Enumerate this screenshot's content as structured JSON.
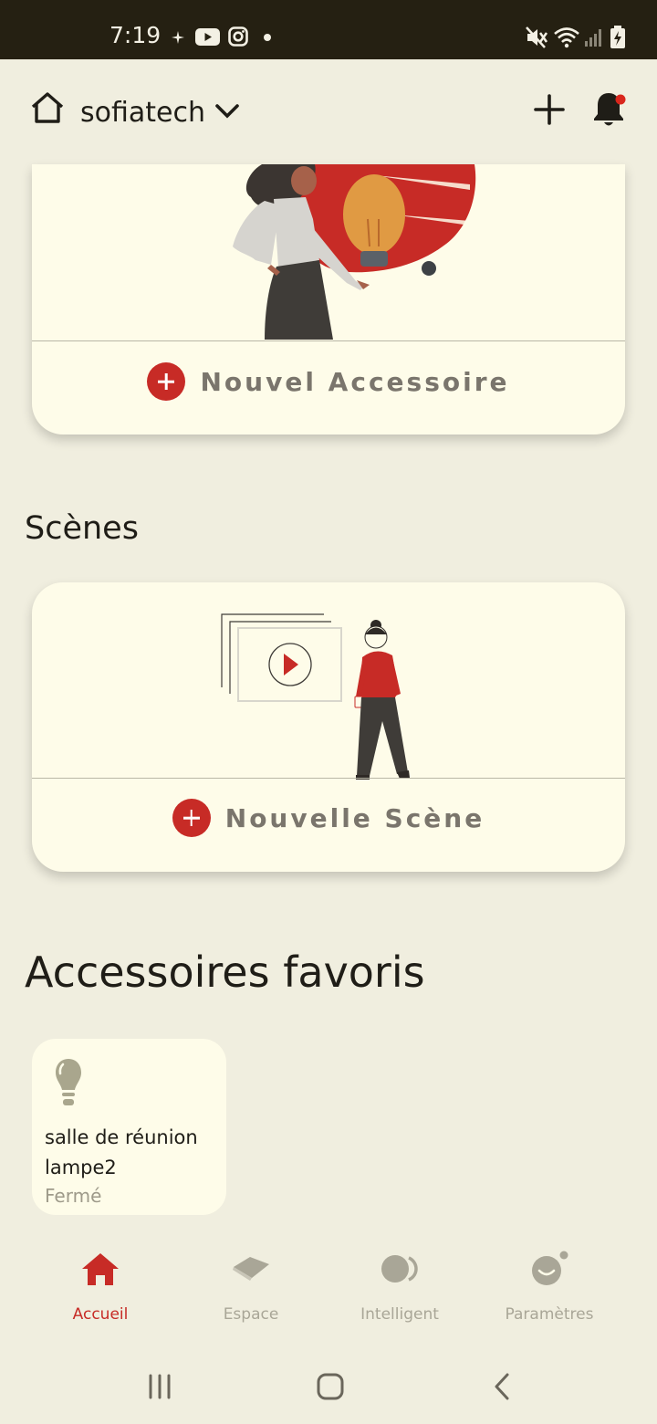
{
  "status_bar": {
    "time": "7:19",
    "left_icons": [
      "sparkle-icon",
      "youtube-icon",
      "instagram-icon",
      "dot-icon"
    ],
    "right_icons": [
      "mute-icon",
      "wifi-icon",
      "signal-icon",
      "battery-charging-icon"
    ]
  },
  "header": {
    "home_name": "sofiatech",
    "icons": [
      "home-icon",
      "chevron-down-icon",
      "add-icon",
      "bell-icon"
    ],
    "notification_dot_color": "#d9261c"
  },
  "accessory_card": {
    "add_label": "Nouvel Accessoire"
  },
  "scenes": {
    "title": "Scènes",
    "add_label": "Nouvelle Scène"
  },
  "favorites": {
    "title": "Accessoires favoris",
    "items": [
      {
        "name": "salle de réunion lampe2",
        "status": "Fermé",
        "icon": "bulb-icon"
      }
    ]
  },
  "bottom_nav": {
    "items": [
      {
        "label": "Accueil",
        "icon": "home-filled-icon",
        "active": true
      },
      {
        "label": "Espace",
        "icon": "space-icon",
        "active": false
      },
      {
        "label": "Intelligent",
        "icon": "intelligent-icon",
        "active": false
      },
      {
        "label": "Paramètres",
        "icon": "settings-face-icon",
        "active": false
      }
    ]
  },
  "system_nav": {
    "icons": [
      "recents-icon",
      "home-circle-icon",
      "back-icon"
    ]
  },
  "colors": {
    "accent": "#c72b26",
    "background": "#f0eedf",
    "card": "#fefce9",
    "status_bar": "#252012"
  }
}
